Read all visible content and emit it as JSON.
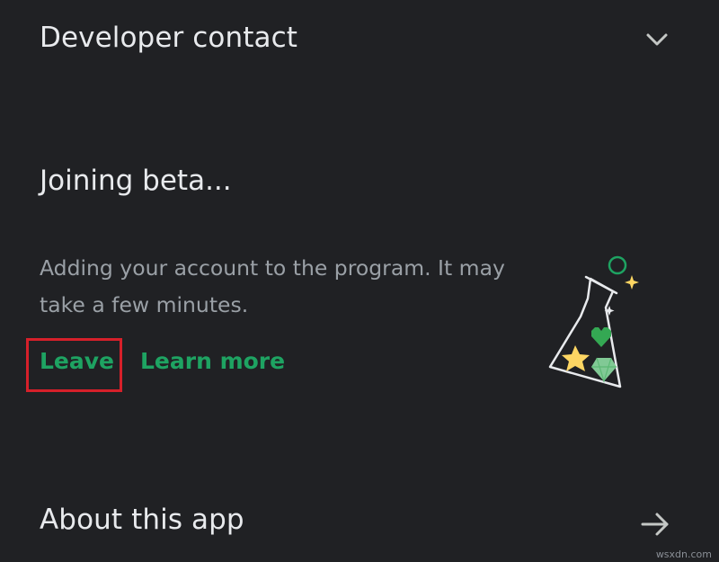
{
  "developer_contact": {
    "title": "Developer contact",
    "icon": "chevron-down-icon"
  },
  "beta": {
    "title": "Joining beta...",
    "description": "Adding your account to the program. It may take a few minutes.",
    "leave_label": "Leave",
    "learn_more_label": "Learn more",
    "illustration": "beta-flask-icon"
  },
  "about": {
    "title": "About this app",
    "icon": "arrow-right-icon"
  },
  "watermark": "wsxdn.com",
  "colors": {
    "background": "#202124",
    "title_text": "#e8eaed",
    "secondary_text": "#9aa0a6",
    "accent_green": "#1ea362",
    "highlight_red": "#d6202a"
  }
}
